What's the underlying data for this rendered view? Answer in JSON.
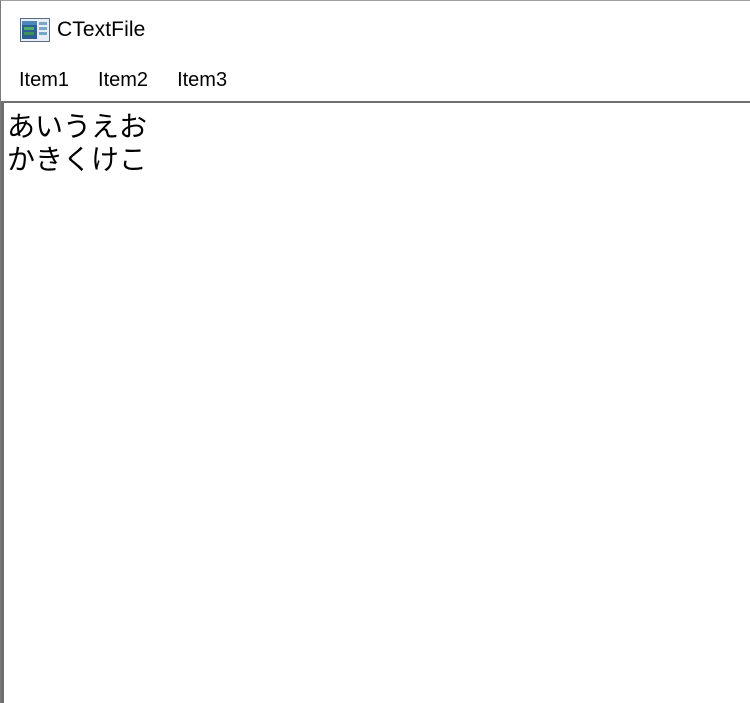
{
  "window": {
    "title": "CTextFile",
    "icon": "app-window-icon"
  },
  "menu": {
    "items": [
      {
        "label": "Item1"
      },
      {
        "label": "Item2"
      },
      {
        "label": "Item3"
      }
    ]
  },
  "editor": {
    "lines": [
      "あいうえお",
      "かきくけこ"
    ]
  },
  "colors": {
    "background": "#ffffff",
    "border": "#6e6e6e",
    "text": "#000000"
  }
}
